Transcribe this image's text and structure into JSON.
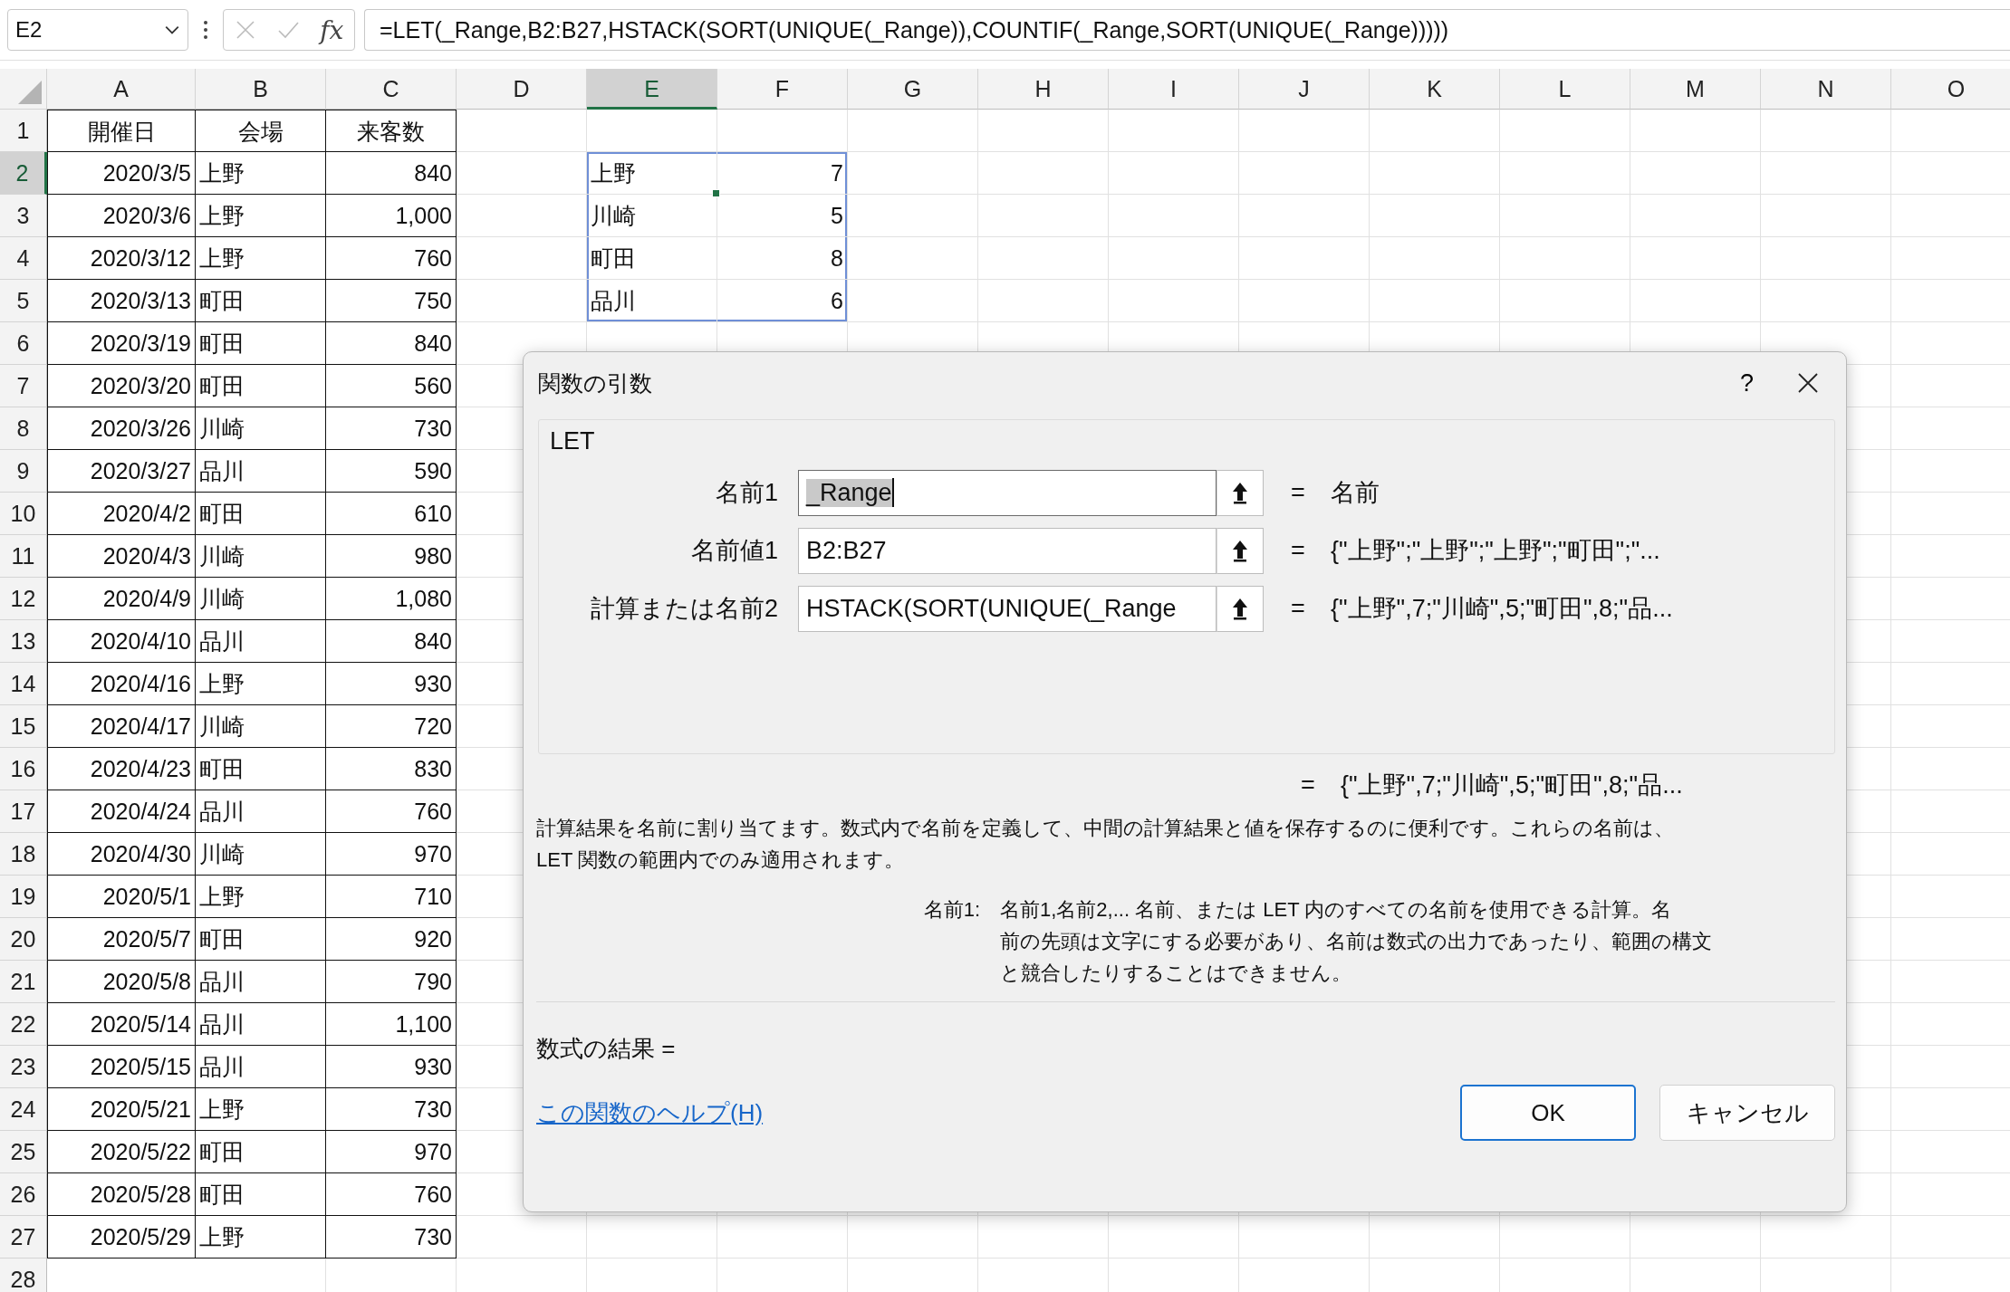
{
  "formula_bar": {
    "name_box": "E2",
    "insert_function": "fx",
    "formula": "=LET(_Range,B2:B27,HSTACK(SORT(UNIQUE(_Range)),COUNTIF(_Range,SORT(UNIQUE(_Range)))))"
  },
  "columns": [
    {
      "label": "A",
      "selected": false
    },
    {
      "label": "B",
      "selected": false
    },
    {
      "label": "C",
      "selected": false
    },
    {
      "label": "D",
      "selected": false
    },
    {
      "label": "E",
      "selected": true
    },
    {
      "label": "F",
      "selected": false
    },
    {
      "label": "G",
      "selected": false
    },
    {
      "label": "H",
      "selected": false
    },
    {
      "label": "I",
      "selected": false
    },
    {
      "label": "J",
      "selected": false
    },
    {
      "label": "K",
      "selected": false
    },
    {
      "label": "L",
      "selected": false
    },
    {
      "label": "M",
      "selected": false
    },
    {
      "label": "N",
      "selected": false
    },
    {
      "label": "O",
      "selected": false
    }
  ],
  "rows": [
    {
      "header": "1",
      "selected": false,
      "cells": [
        "開催日",
        "会場",
        "来客数"
      ]
    },
    {
      "header": "2",
      "selected": true,
      "cells": [
        "2020/3/5",
        "上野",
        "840"
      ],
      "spill": [
        {
          "text": "上野",
          "active": true
        },
        {
          "text": "7",
          "active": false
        }
      ]
    },
    {
      "header": "3",
      "selected": false,
      "cells": [
        "2020/3/6",
        "上野",
        "1,000"
      ],
      "spill": [
        {
          "text": "川崎",
          "active": false
        },
        {
          "text": "5",
          "active": false
        }
      ]
    },
    {
      "header": "4",
      "selected": false,
      "cells": [
        "2020/3/12",
        "上野",
        "760"
      ],
      "spill": [
        {
          "text": "町田",
          "active": false
        },
        {
          "text": "8",
          "active": false
        }
      ]
    },
    {
      "header": "5",
      "selected": false,
      "cells": [
        "2020/3/13",
        "町田",
        "750"
      ],
      "spill": [
        {
          "text": "品川",
          "active": false
        },
        {
          "text": "6",
          "active": false
        }
      ]
    },
    {
      "header": "6",
      "selected": false,
      "cells": [
        "2020/3/19",
        "町田",
        "840"
      ]
    },
    {
      "header": "7",
      "selected": false,
      "cells": [
        "2020/3/20",
        "町田",
        "560"
      ]
    },
    {
      "header": "8",
      "selected": false,
      "cells": [
        "2020/3/26",
        "川崎",
        "730"
      ]
    },
    {
      "header": "9",
      "selected": false,
      "cells": [
        "2020/3/27",
        "品川",
        "590"
      ]
    },
    {
      "header": "10",
      "selected": false,
      "cells": [
        "2020/4/2",
        "町田",
        "610"
      ]
    },
    {
      "header": "11",
      "selected": false,
      "cells": [
        "2020/4/3",
        "川崎",
        "980"
      ]
    },
    {
      "header": "12",
      "selected": false,
      "cells": [
        "2020/4/9",
        "川崎",
        "1,080"
      ]
    },
    {
      "header": "13",
      "selected": false,
      "cells": [
        "2020/4/10",
        "品川",
        "840"
      ]
    },
    {
      "header": "14",
      "selected": false,
      "cells": [
        "2020/4/16",
        "上野",
        "930"
      ]
    },
    {
      "header": "15",
      "selected": false,
      "cells": [
        "2020/4/17",
        "川崎",
        "720"
      ]
    },
    {
      "header": "16",
      "selected": false,
      "cells": [
        "2020/4/23",
        "町田",
        "830"
      ]
    },
    {
      "header": "17",
      "selected": false,
      "cells": [
        "2020/4/24",
        "品川",
        "760"
      ]
    },
    {
      "header": "18",
      "selected": false,
      "cells": [
        "2020/4/30",
        "川崎",
        "970"
      ]
    },
    {
      "header": "19",
      "selected": false,
      "cells": [
        "2020/5/1",
        "上野",
        "710"
      ]
    },
    {
      "header": "20",
      "selected": false,
      "cells": [
        "2020/5/7",
        "町田",
        "920"
      ]
    },
    {
      "header": "21",
      "selected": false,
      "cells": [
        "2020/5/8",
        "品川",
        "790"
      ]
    },
    {
      "header": "22",
      "selected": false,
      "cells": [
        "2020/5/14",
        "品川",
        "1,100"
      ]
    },
    {
      "header": "23",
      "selected": false,
      "cells": [
        "2020/5/15",
        "品川",
        "930"
      ]
    },
    {
      "header": "24",
      "selected": false,
      "cells": [
        "2020/5/21",
        "上野",
        "730"
      ]
    },
    {
      "header": "25",
      "selected": false,
      "cells": [
        "2020/5/22",
        "町田",
        "970"
      ]
    },
    {
      "header": "26",
      "selected": false,
      "cells": [
        "2020/5/28",
        "町田",
        "760"
      ]
    },
    {
      "header": "27",
      "selected": false,
      "cells": [
        "2020/5/29",
        "上野",
        "730"
      ]
    },
    {
      "header": "28",
      "selected": false,
      "cells": []
    }
  ],
  "dialog": {
    "title": "関数の引数",
    "help_button": "?",
    "function_name": "LET",
    "arguments": [
      {
        "label": "名前1",
        "value": "_Range",
        "focused": true,
        "equals": "=",
        "result": "名前"
      },
      {
        "label": "名前値1",
        "value": "B2:B27",
        "focused": false,
        "equals": "=",
        "result": "{\"上野\";\"上野\";\"上野\";\"町田\";\"..."
      },
      {
        "label": "計算または名前2",
        "value": "HSTACK(SORT(UNIQUE(_Range",
        "focused": false,
        "equals": "=",
        "result": "{\"上野\",7;\"川崎\",5;\"町田\",8;\"品..."
      }
    ],
    "preview": {
      "equals": "=",
      "result": "{\"上野\",7;\"川崎\",5;\"町田\",8;\"品..."
    },
    "description": [
      "計算結果を名前に割り当てます。数式内で名前を定義して、中間の計算結果と値を保存するのに便利です。これらの名前は、",
      "LET 関数の範囲内でのみ適用されます。"
    ],
    "argument_help": {
      "label": "名前1:",
      "lines": [
        "名前1,名前2,... 名前、または LET 内のすべての名前を使用できる計算。名",
        "前の先頭は文字にする必要があり、名前は数式の出力であったり、範囲の構文",
        "と競合したりすることはできません。"
      ]
    },
    "formula_result": "数式の結果 =",
    "help_link": "この関数のヘルプ(H)",
    "buttons": [
      {
        "label": "OK",
        "default": true
      },
      {
        "label": "キャンセル",
        "default": false
      }
    ]
  }
}
